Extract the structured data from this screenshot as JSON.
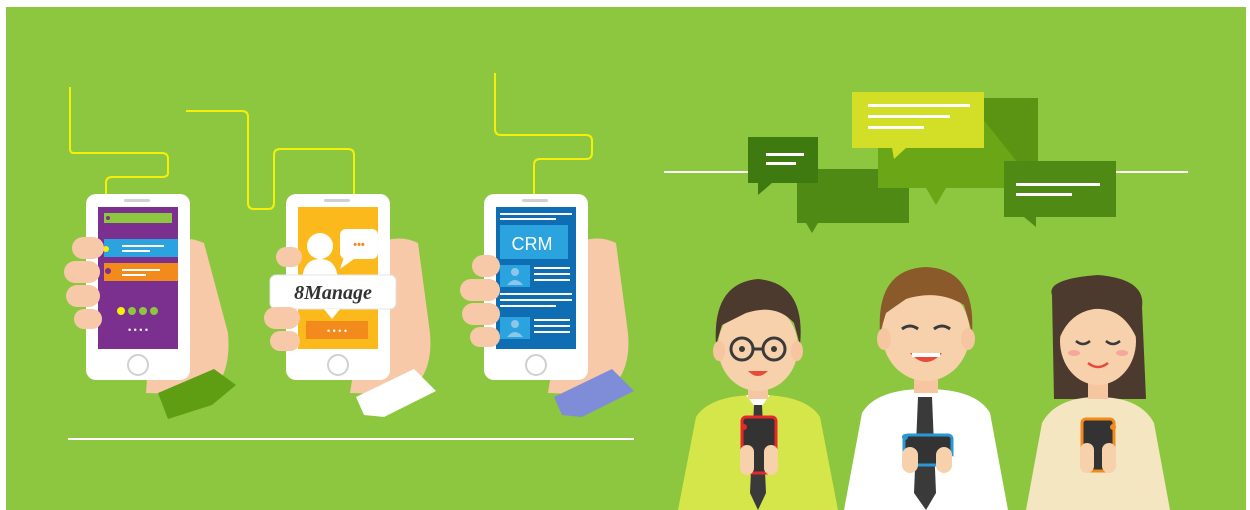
{
  "colors": {
    "background": "#8dc63f",
    "connector": "#f5f00a",
    "phone_purple": "#7b2f8e",
    "phone_yellow": "#fbb91b",
    "phone_blue": "#0f6db3",
    "bubble_dark_green": "#3f7a10",
    "bubble_lime": "#d3de26"
  },
  "phones": [
    {
      "name": "purple-app-phone",
      "screen_color": "#7b2f8e"
    },
    {
      "name": "brand-phone",
      "screen_color": "#fbb91b"
    },
    {
      "name": "crm-phone",
      "screen_color": "#0f6db3"
    }
  ],
  "brand": {
    "logo_text": "8Manage",
    "chat_dots": "•••",
    "pager_dots": "• • • •"
  },
  "crm": {
    "title": "CRM"
  },
  "people": [
    {
      "name": "man-with-glasses",
      "phone_accent": "#e8272a",
      "shirt": "#d5e64a"
    },
    {
      "name": "man-brown-hair",
      "phone_accent": "#2a98d5",
      "shirt": "#ffffff"
    },
    {
      "name": "woman-long-hair",
      "phone_accent": "#f28a1c",
      "shirt": "#f4e6c0"
    }
  ],
  "icons": [
    "phone-icon",
    "person-icon",
    "chat-bubble-icon",
    "speech-bubble-icon"
  ]
}
